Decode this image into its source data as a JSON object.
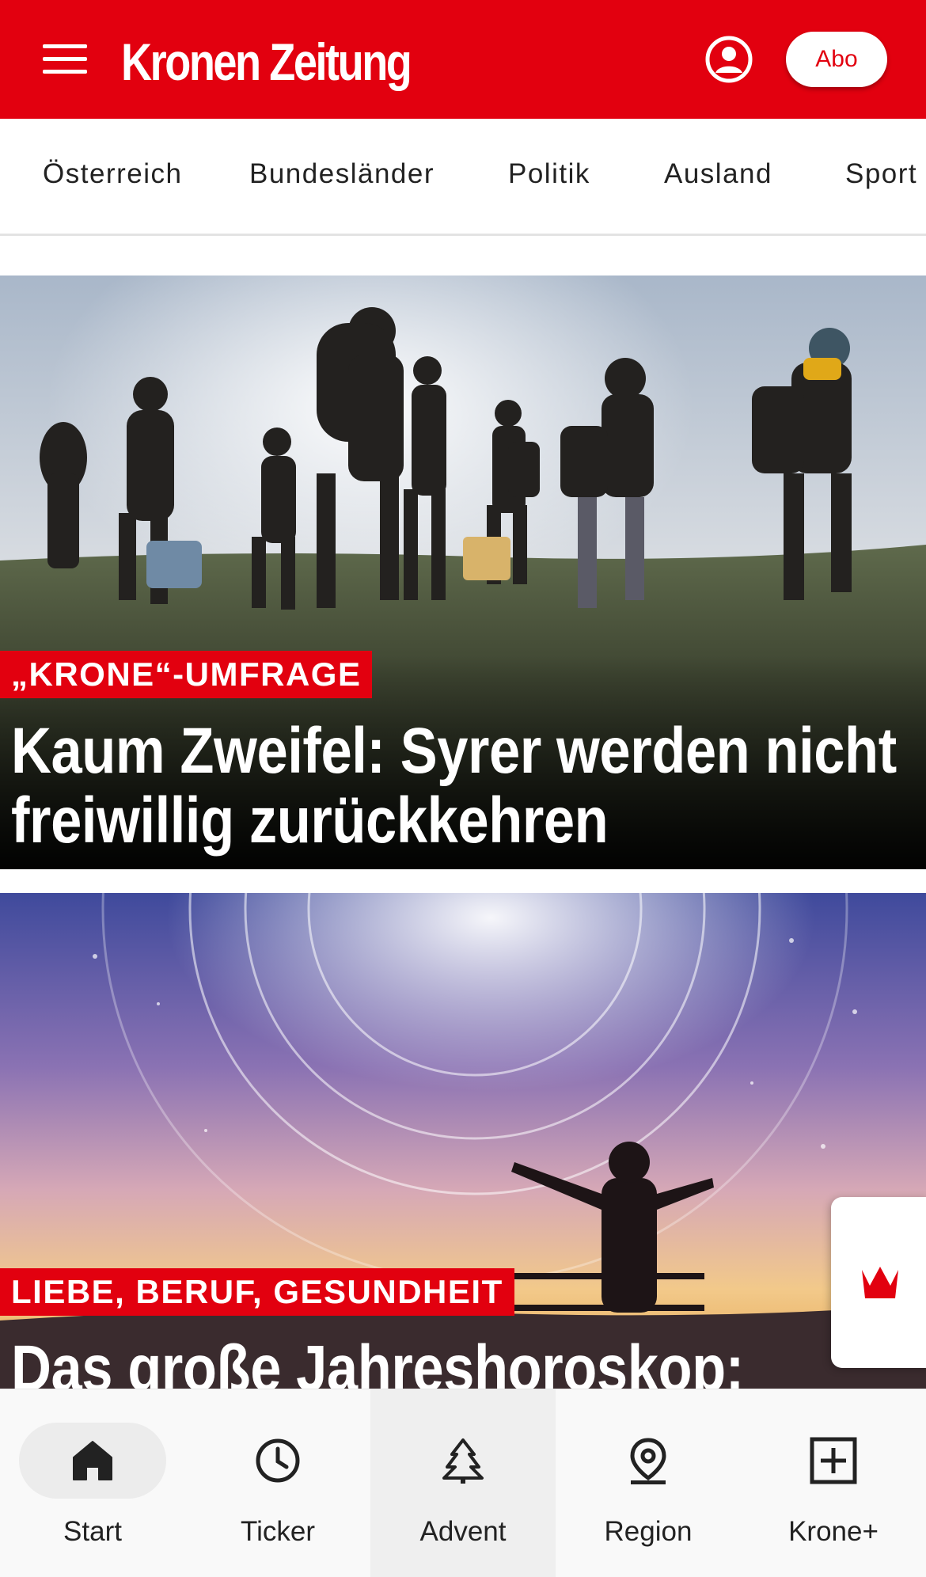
{
  "header": {
    "logo": "Kronen Zeitung",
    "abo_label": "Abo"
  },
  "categories": [
    "Österreich",
    "Bundesländer",
    "Politik",
    "Ausland",
    "Sport"
  ],
  "articles": [
    {
      "kicker": "„KRONE“-UMFRAGE",
      "headline": "Kaum Zweifel: Syrer werden nicht freiwillig zurückkehren"
    },
    {
      "kicker": "LIEBE, BERUF, GESUNDHEIT",
      "headline": "Das große Jahreshoroskop:"
    }
  ],
  "bottom_nav": [
    {
      "label": "Start",
      "icon": "home-icon",
      "active": true
    },
    {
      "label": "Ticker",
      "icon": "clock-icon"
    },
    {
      "label": "Advent",
      "icon": "tree-icon"
    },
    {
      "label": "Region",
      "icon": "location-pin-icon"
    },
    {
      "label": "Krone+",
      "icon": "plus-box-icon"
    }
  ],
  "colors": {
    "brand_red": "#e2000f",
    "nav_background": "#f9f9f9",
    "text_dark": "#222222"
  }
}
